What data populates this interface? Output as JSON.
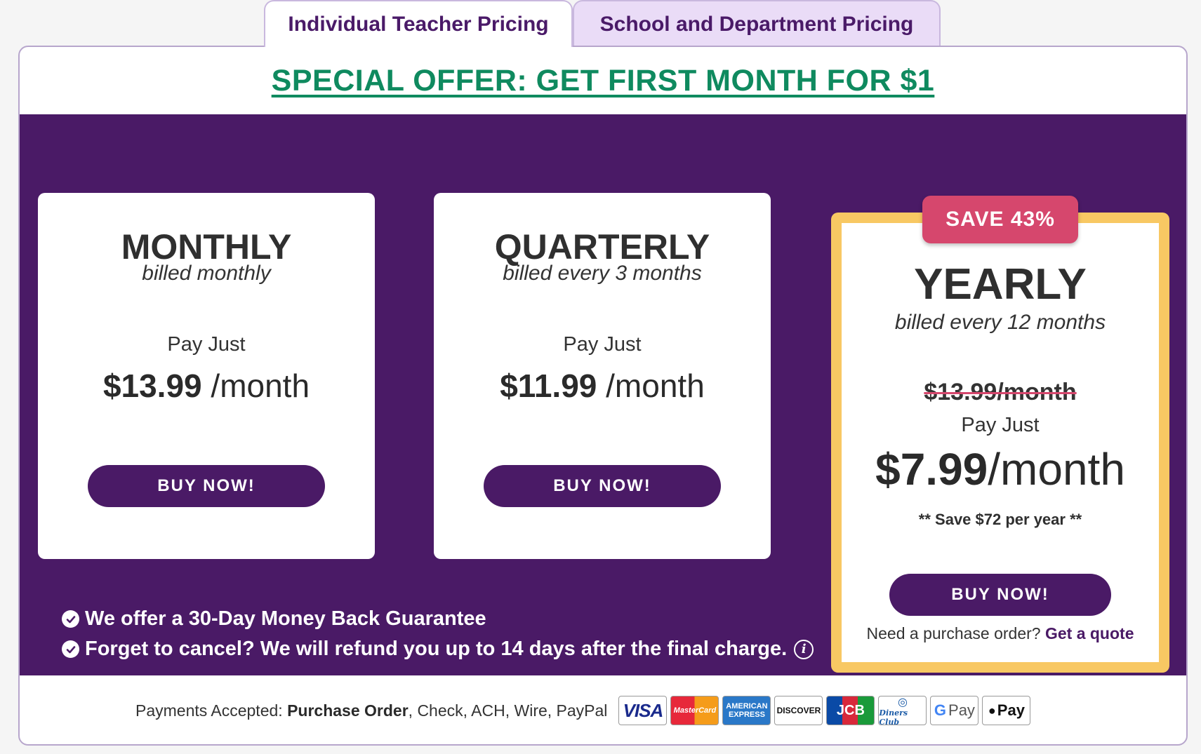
{
  "tabs": [
    {
      "label": "Individual Teacher Pricing",
      "active": true
    },
    {
      "label": "School and Department Pricing",
      "active": false
    }
  ],
  "offer": {
    "text": "SPECIAL OFFER: GET FIRST MONTH FOR $1"
  },
  "plans": {
    "monthly": {
      "title": "MONTHLY",
      "subtitle": "billed monthly",
      "pay_just": "Pay Just",
      "price": "$13.99",
      "unit": "/month",
      "button": "BUY NOW!"
    },
    "quarterly": {
      "title": "QUARTERLY",
      "subtitle": "billed every 3 months",
      "pay_just": "Pay Just",
      "price": "$11.99",
      "unit": "/month",
      "button": "BUY NOW!"
    },
    "yearly": {
      "badge": "SAVE  43%",
      "title": "YEARLY",
      "subtitle": "billed every 12 months",
      "old_price": "$13.99/month",
      "pay_just": "Pay Just",
      "price": "$7.99",
      "unit": "/month",
      "save_note": "** Save $72 per year **",
      "button": "BUY NOW!",
      "po_text": "Need a purchase order?",
      "po_link": "Get a quote"
    }
  },
  "guarantees": [
    "We offer a 30-Day Money Back Guarantee",
    "Forget to cancel? We will refund you up to 14 days after the final charge."
  ],
  "payments": {
    "prefix": "Payments Accepted: ",
    "bold": "Purchase Order",
    "rest": ", Check, ACH, Wire, PayPal",
    "logos": {
      "visa": "VISA",
      "mastercard": "MasterCard",
      "amex_1": "AMERICAN",
      "amex_2": "EXPRESS",
      "discover": "DISCOVER",
      "jcb": "JCB",
      "diners": "Diners Club",
      "gpay": "Pay",
      "applepay": "Pay"
    }
  },
  "colors": {
    "brand_purple": "#4a1a66",
    "offer_green": "#0f8a5f",
    "badge_pink": "#d6476d",
    "highlight_border": "#f8c863"
  }
}
